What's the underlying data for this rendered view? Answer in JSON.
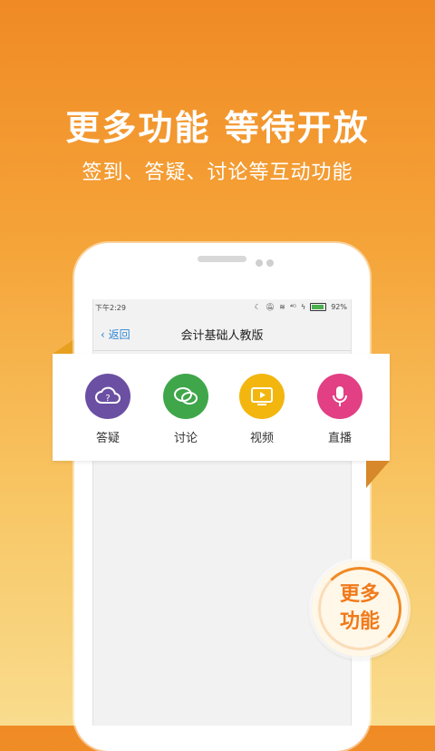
{
  "promo": {
    "headline": "更多功能  等待开放",
    "subline": "签到、答疑、讨论等互动功能"
  },
  "status_bar": {
    "time": "下午2:29",
    "signal": "⁴ᴳ",
    "battery_percent": "92%",
    "battery_level": 0.92
  },
  "nav": {
    "back_label": "返回",
    "title": "会计基础人教版"
  },
  "features": [
    {
      "label": "答疑",
      "color": "#6b4fa3",
      "icon": "question-cloud-icon"
    },
    {
      "label": "讨论",
      "color": "#3fa64a",
      "icon": "chat-bubbles-icon"
    },
    {
      "label": "视频",
      "color": "#f2b60f",
      "icon": "video-play-icon"
    },
    {
      "label": "直播",
      "color": "#e23f84",
      "icon": "microphone-icon"
    }
  ],
  "badge": {
    "line1": "更多",
    "line2": "功能"
  },
  "colors": {
    "accent": "#f08a24",
    "link": "#2f86d6"
  }
}
